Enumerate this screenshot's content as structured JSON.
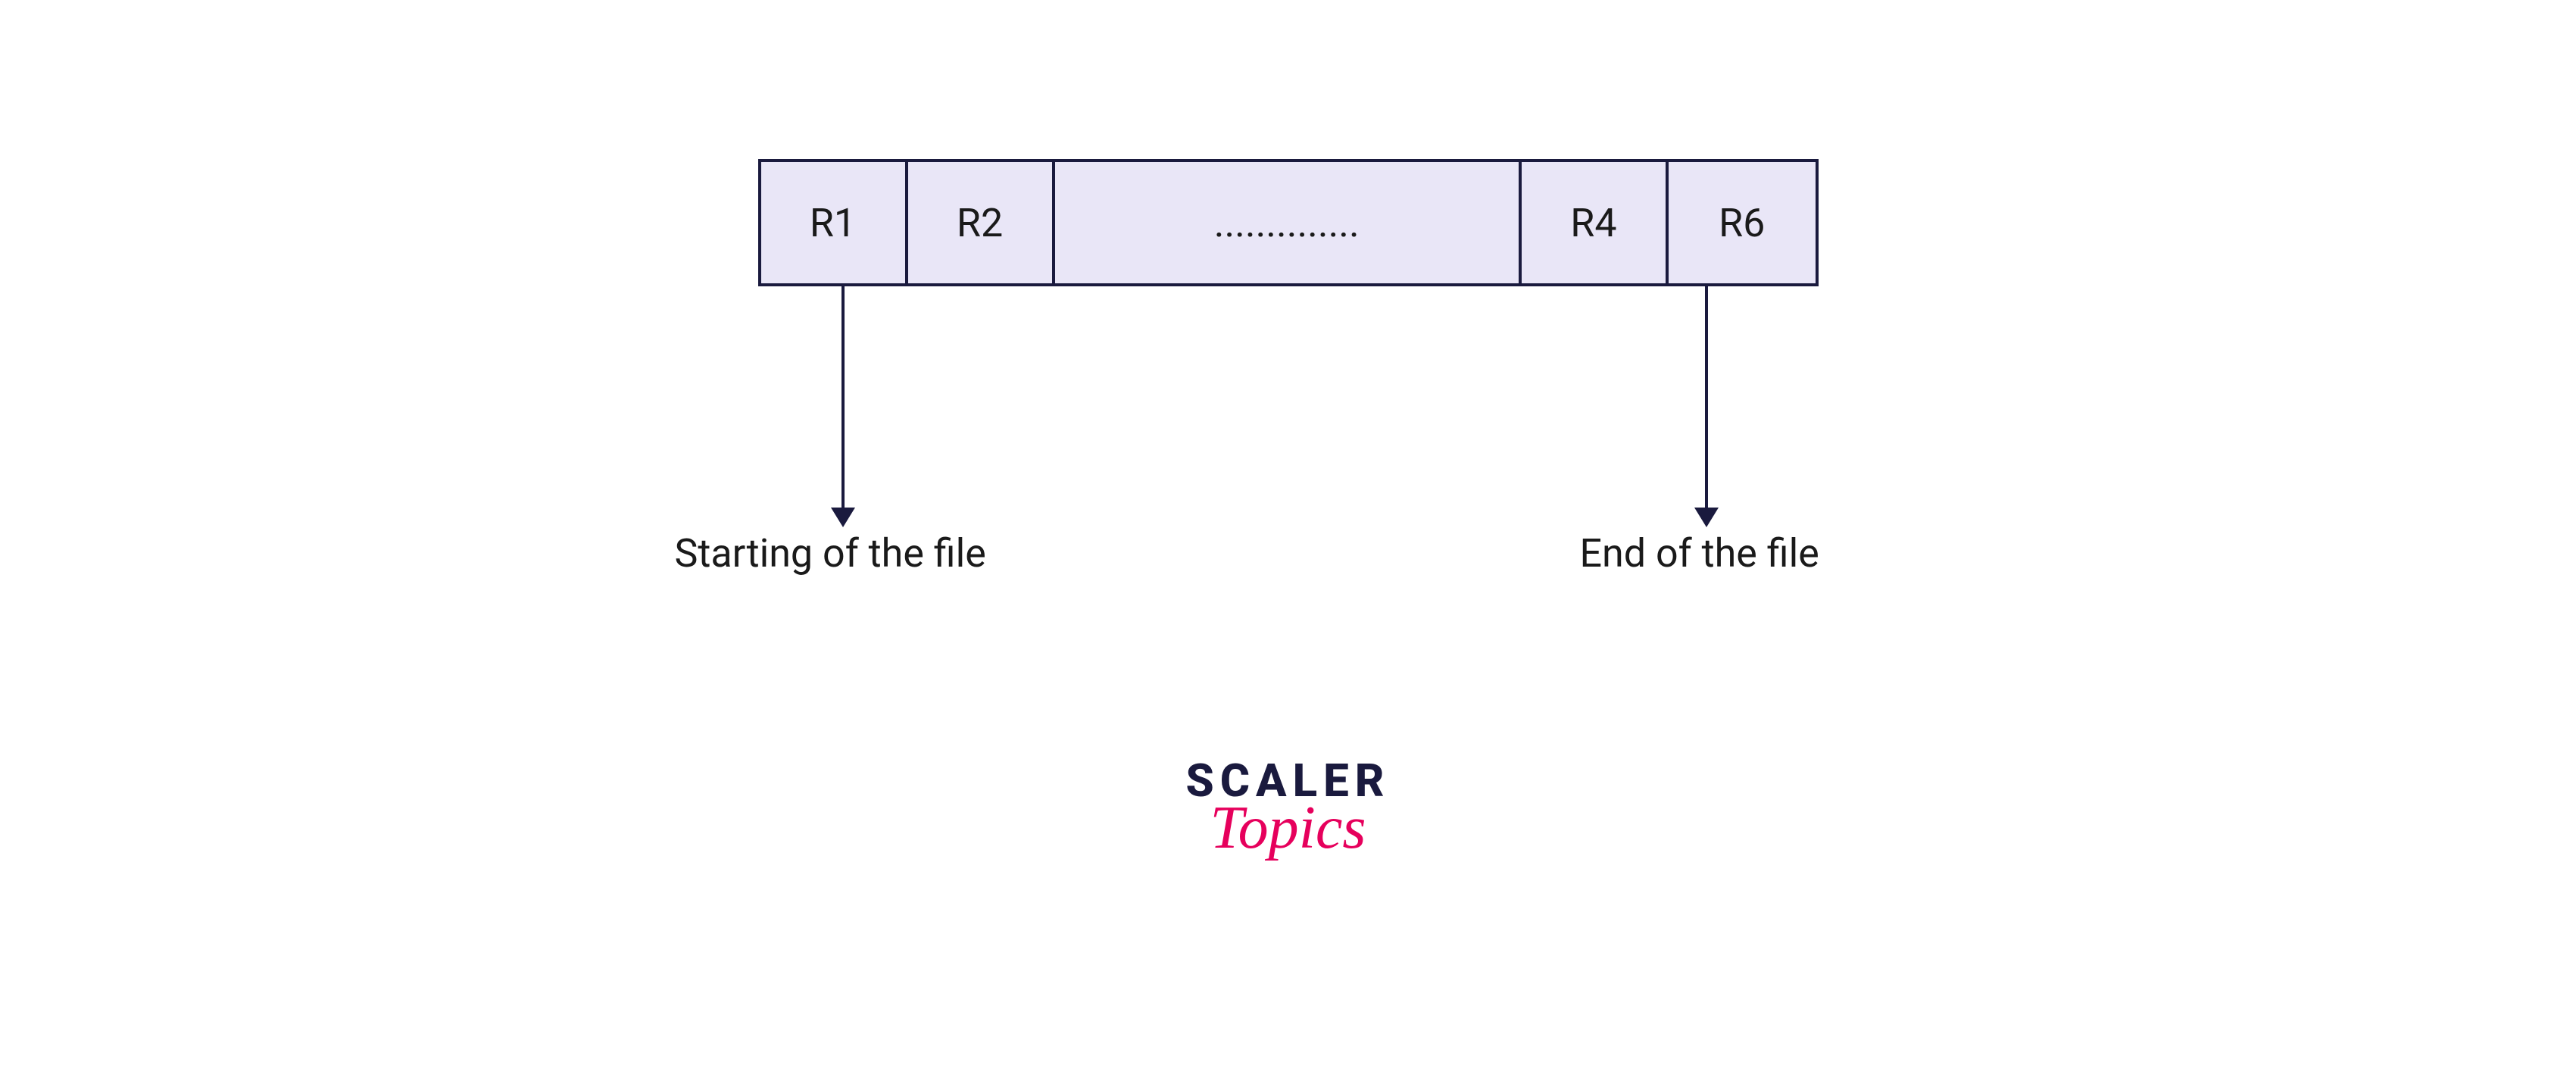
{
  "cells": [
    "R1",
    "R2",
    "..............",
    "R4",
    "R6"
  ],
  "labels": {
    "start": "Starting of the file",
    "end": "End of the file"
  },
  "logo": {
    "main": "SCALER",
    "sub": "Topics"
  }
}
